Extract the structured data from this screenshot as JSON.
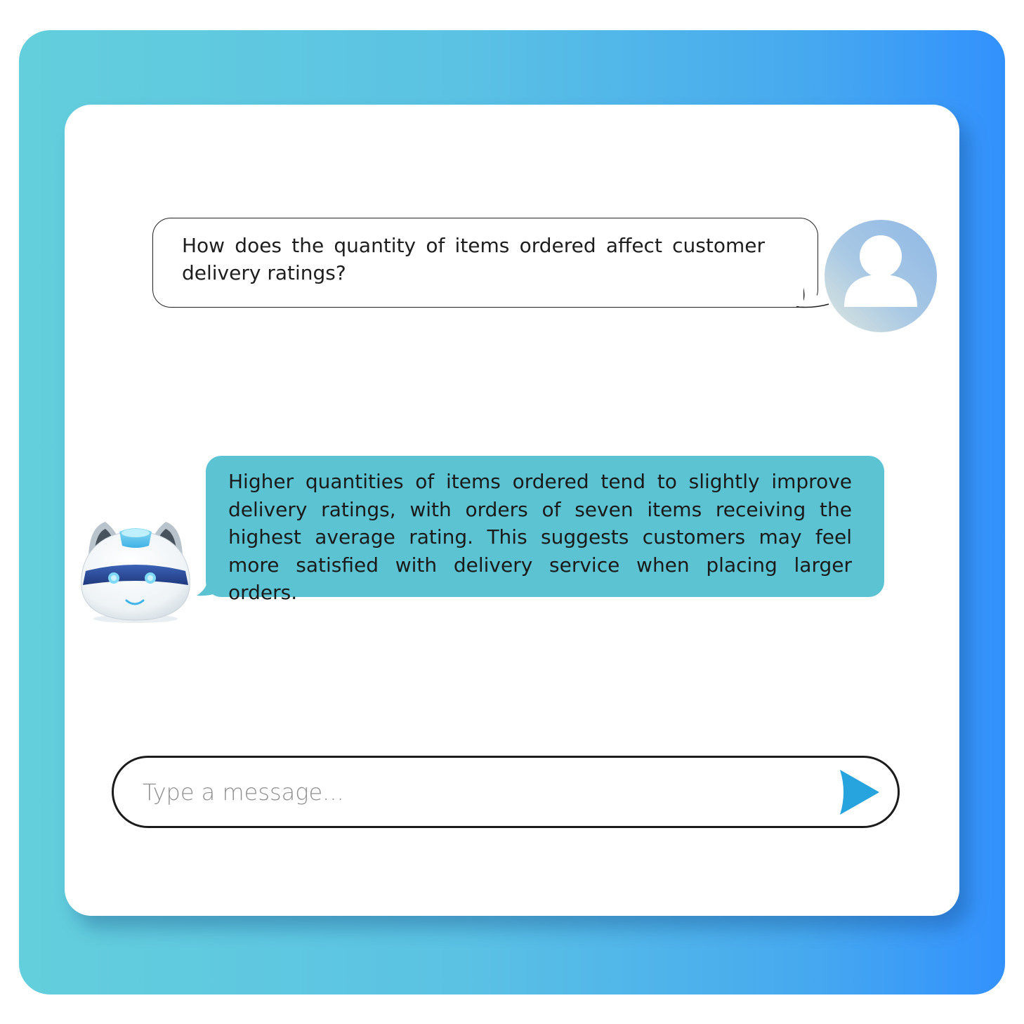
{
  "chat": {
    "messages": [
      {
        "sender": "user",
        "text": "How does the quantity of items ordered affect customer delivery ratings?"
      },
      {
        "sender": "bot",
        "text": "Higher quantities of items ordered tend to slightly improve delivery ratings, with orders of seven items receiving the highest average rating. This suggests customers may feel more satisfied with delivery service when placing larger orders."
      }
    ]
  },
  "composer": {
    "placeholder": "Type a message..."
  },
  "icons": {
    "user_avatar": "user-avatar-icon",
    "bot_avatar": "robot-avatar-icon",
    "send": "send-arrow-icon"
  },
  "colors": {
    "frame_gradient_start": "#63cfdc",
    "frame_gradient_end": "#3391fd",
    "bot_bubble": "#5cc3d2",
    "send_arrow": "#27a3de"
  }
}
